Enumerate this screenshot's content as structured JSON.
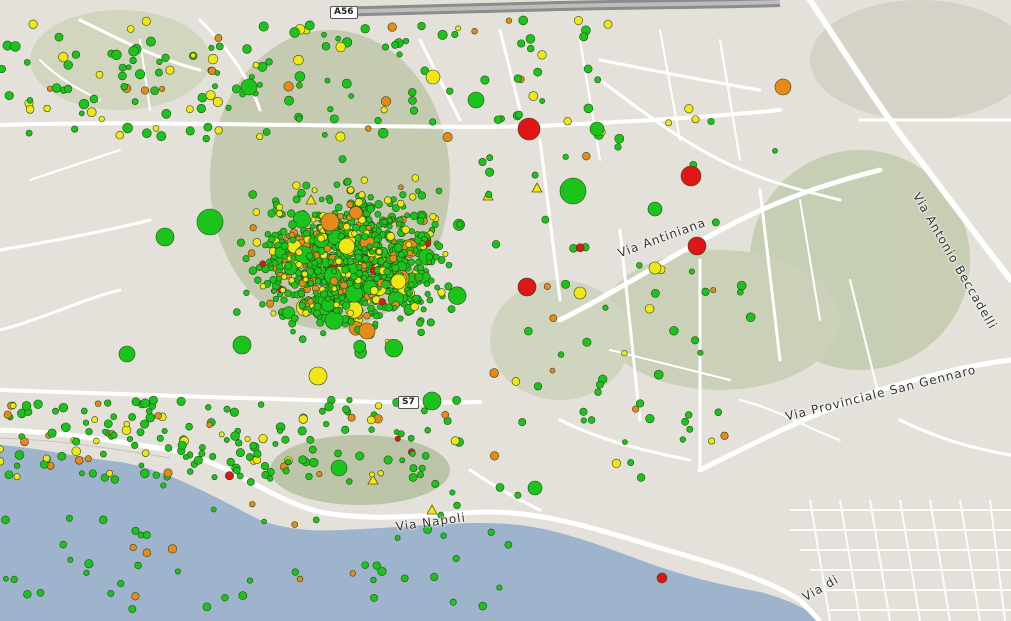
{
  "map": {
    "colors": {
      "sea": "#9db4cc",
      "land": "#e4e1da",
      "hill": "#a8b98f",
      "road": "#ffffff",
      "road_casing": "#b9b6b0",
      "highway": "#8a8a8a",
      "marker_green": "#1bc41b",
      "marker_yellow": "#f2e614",
      "marker_orange": "#e8891a",
      "marker_red": "#e01515"
    },
    "road_labels": {
      "a56": "A56",
      "antiniana": "Via Antiniana",
      "beccadelli": "Via Antonio Beccadelli",
      "san_gennaro": "Via Provinciale San Gennaro",
      "napoli": "Via Napoli",
      "via_di": "Via di",
      "s7": "S7"
    },
    "marker_categories": [
      "green",
      "yellow",
      "orange",
      "red"
    ],
    "marker_shapes": [
      "circle",
      "triangle"
    ]
  }
}
